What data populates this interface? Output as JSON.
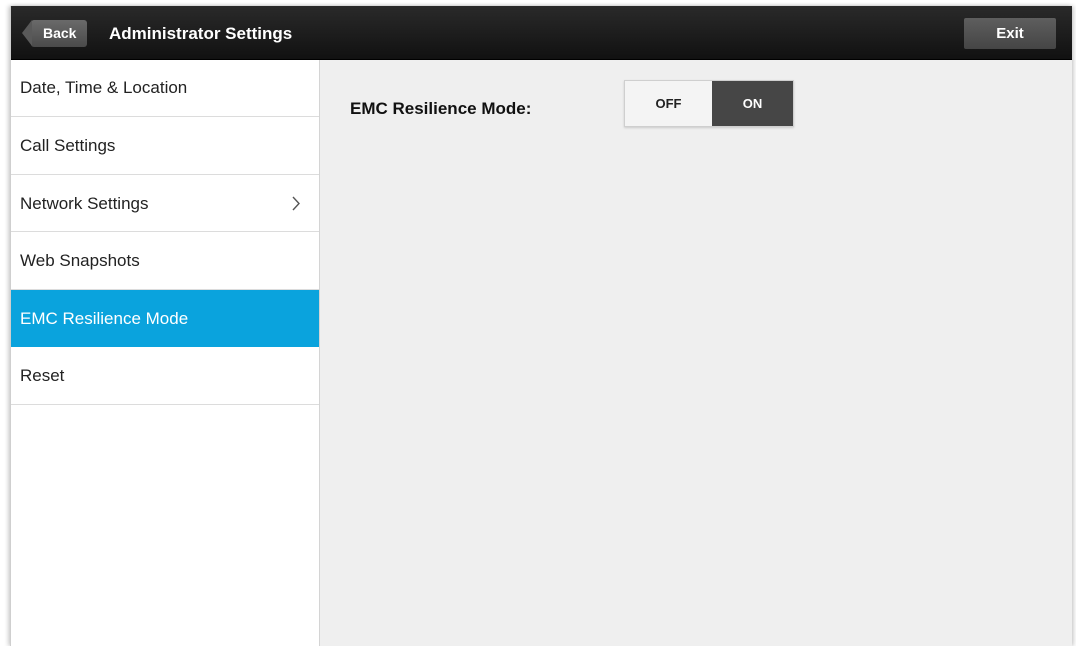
{
  "header": {
    "back_label": "Back",
    "title": "Administrator Settings",
    "exit_label": "Exit"
  },
  "sidebar": {
    "items": [
      {
        "label": "Date, Time & Location",
        "selected": false
      },
      {
        "label": "Call Settings",
        "selected": false
      },
      {
        "label": "Network Settings",
        "selected": false,
        "has_submenu": true,
        "icon": "chevron-right-icon"
      },
      {
        "label": "Web Snapshots",
        "selected": false
      },
      {
        "label": "EMC Resilience Mode",
        "selected": true
      },
      {
        "label": "Reset",
        "selected": false
      }
    ]
  },
  "main": {
    "setting_label": "EMC Resilience Mode:",
    "toggle": {
      "off_label": "OFF",
      "on_label": "ON",
      "value": "ON"
    }
  },
  "colors": {
    "header_bg": "#1a1a1a",
    "selected_bg": "#0aa3dd",
    "toggle_on_bg": "#464646",
    "content_bg": "#efefef"
  }
}
